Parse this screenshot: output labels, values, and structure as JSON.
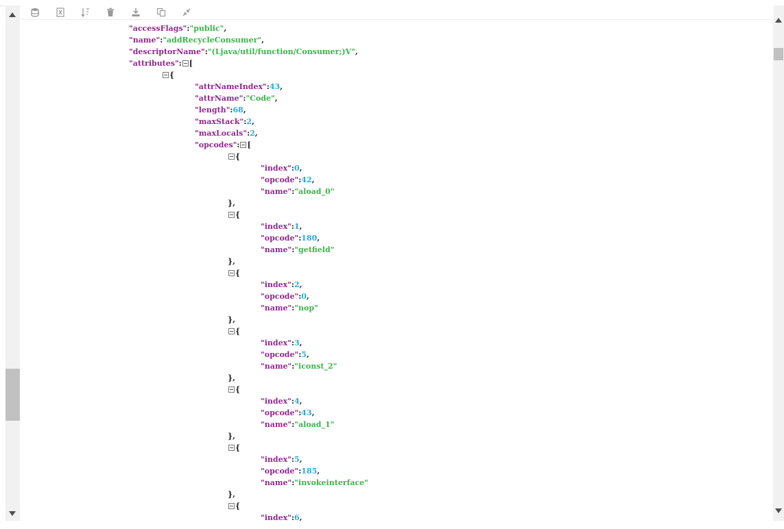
{
  "toolbar": {
    "icons": [
      "database-icon",
      "excel-icon",
      "sort-icon",
      "trash-icon",
      "download-icon",
      "copy-icon",
      "collapse-icon"
    ]
  },
  "colors": {
    "key": "#92278f",
    "string": "#3ab54a",
    "number": "#25aae2",
    "punct": "#222222"
  },
  "lines": [
    {
      "indent": 0,
      "key": "accessFlags",
      "string": "public",
      "tail": ","
    },
    {
      "indent": 0,
      "key": "name",
      "string": "addRecycleConsumer",
      "tail": ","
    },
    {
      "indent": 0,
      "key": "descriptorName",
      "string": "(Ljava/util/function/Consumer;)V",
      "tail": ","
    },
    {
      "indent": 0,
      "key": "attributes",
      "open": "["
    },
    {
      "indent": 1,
      "open": "{"
    },
    {
      "indent": 2,
      "key": "attrNameIndex",
      "number": "43",
      "tail": ","
    },
    {
      "indent": 2,
      "key": "attrName",
      "string": "Code",
      "tail": ","
    },
    {
      "indent": 2,
      "key": "length",
      "number": "68",
      "tail": ","
    },
    {
      "indent": 2,
      "key": "maxStack",
      "number": "2",
      "tail": ","
    },
    {
      "indent": 2,
      "key": "maxLocals",
      "number": "2",
      "tail": ","
    },
    {
      "indent": 2,
      "key": "opcodes",
      "open": "["
    },
    {
      "indent": 3,
      "open": "{"
    },
    {
      "indent": 4,
      "key": "index",
      "number": "0",
      "tail": ","
    },
    {
      "indent": 4,
      "key": "opcode",
      "number": "42",
      "tail": ","
    },
    {
      "indent": 4,
      "key": "name",
      "string": "aload_0"
    },
    {
      "indent": 3,
      "close": "},"
    },
    {
      "indent": 3,
      "open": "{"
    },
    {
      "indent": 4,
      "key": "index",
      "number": "1",
      "tail": ","
    },
    {
      "indent": 4,
      "key": "opcode",
      "number": "180",
      "tail": ","
    },
    {
      "indent": 4,
      "key": "name",
      "string": "getfield"
    },
    {
      "indent": 3,
      "close": "},"
    },
    {
      "indent": 3,
      "open": "{"
    },
    {
      "indent": 4,
      "key": "index",
      "number": "2",
      "tail": ","
    },
    {
      "indent": 4,
      "key": "opcode",
      "number": "0",
      "tail": ","
    },
    {
      "indent": 4,
      "key": "name",
      "string": "nop"
    },
    {
      "indent": 3,
      "close": "},"
    },
    {
      "indent": 3,
      "open": "{"
    },
    {
      "indent": 4,
      "key": "index",
      "number": "3",
      "tail": ","
    },
    {
      "indent": 4,
      "key": "opcode",
      "number": "5",
      "tail": ","
    },
    {
      "indent": 4,
      "key": "name",
      "string": "iconst_2"
    },
    {
      "indent": 3,
      "close": "},"
    },
    {
      "indent": 3,
      "open": "{"
    },
    {
      "indent": 4,
      "key": "index",
      "number": "4",
      "tail": ","
    },
    {
      "indent": 4,
      "key": "opcode",
      "number": "43",
      "tail": ","
    },
    {
      "indent": 4,
      "key": "name",
      "string": "aload_1"
    },
    {
      "indent": 3,
      "close": "},"
    },
    {
      "indent": 3,
      "open": "{"
    },
    {
      "indent": 4,
      "key": "index",
      "number": "5",
      "tail": ","
    },
    {
      "indent": 4,
      "key": "opcode",
      "number": "185",
      "tail": ","
    },
    {
      "indent": 4,
      "key": "name",
      "string": "invokeinterface"
    },
    {
      "indent": 3,
      "close": "},"
    },
    {
      "indent": 3,
      "open": "{"
    },
    {
      "indent": 4,
      "key": "index",
      "number": "6",
      "tail": ","
    }
  ]
}
